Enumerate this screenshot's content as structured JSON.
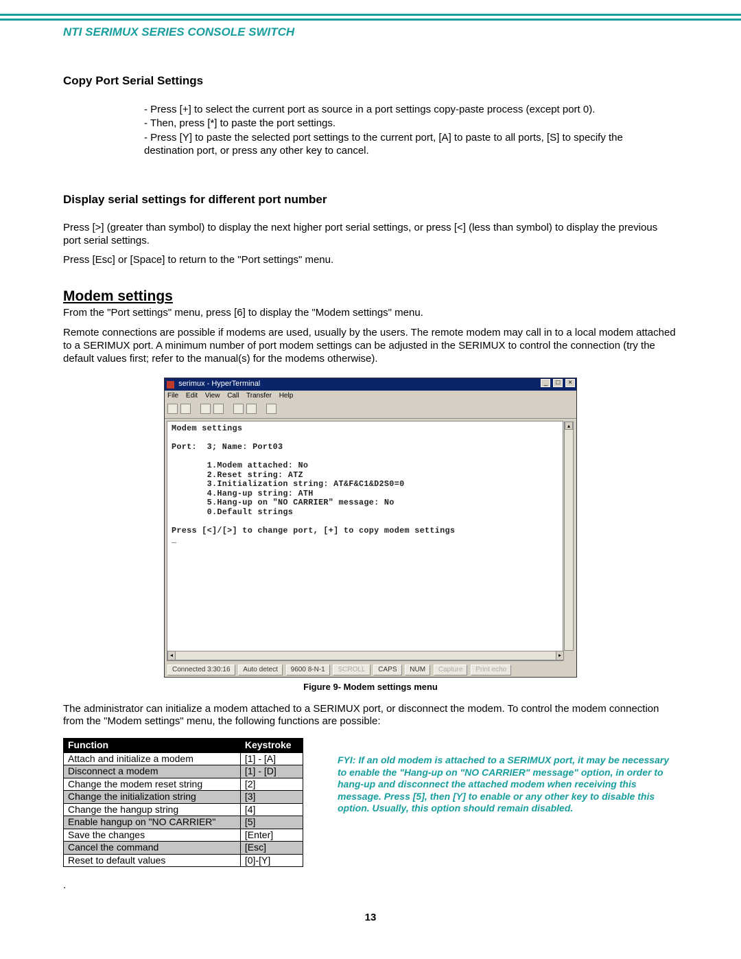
{
  "header": {
    "title": "NTI SERIMUX SERIES CONSOLE SWITCH"
  },
  "section1": {
    "heading": "Copy Port Serial Settings",
    "bullets": [
      "Press [+] to select the current port as source in a port settings copy-paste process (except port 0).",
      "Then, press [*] to paste the port settings.",
      "Press [Y]  to paste the selected port settings to the current port, [A] to paste to all ports, [S] to specify the destination port, or press any other key to cancel."
    ]
  },
  "section2": {
    "heading": "Display serial settings for different port number",
    "p1": "Press [>] (greater than symbol) to display the next higher port serial settings, or press [<] (less than symbol) to display the previous port serial settings.",
    "p2": "Press [Esc] or [Space] to return to the \"Port settings\" menu."
  },
  "section3": {
    "heading": "Modem settings",
    "p1": "From the \"Port settings\" menu, press [6] to display the \"Modem settings\" menu.",
    "p2": "Remote connections are possible if modems are used, usually by the users. The remote modem may call in to a local modem attached to a SERIMUX port.  A minimum number of port modem settings can be adjusted in the SERIMUX to control the connection (try the default values first; refer to the manual(s) for the modems otherwise)."
  },
  "terminal": {
    "windowTitle": "serimux - HyperTerminal",
    "menus": {
      "m0": "File",
      "m1": "Edit",
      "m2": "View",
      "m3": "Call",
      "m4": "Transfer",
      "m5": "Help"
    },
    "body": "Modem settings\n\nPort:  3; Name: Port03\n\n       1.Modem attached: No\n       2.Reset string: ATZ\n       3.Initialization string: AT&F&C1&D2S0=0\n       4.Hang-up string: ATH\n       5.Hang-up on \"NO CARRIER\" message: No\n       0.Default strings\n\nPress [<]/[>] to change port, [+] to copy modem settings\n_",
    "status": {
      "s0": "Connected 3:30:16",
      "s1": "Auto detect",
      "s2": "9600 8-N-1",
      "s3": "SCROLL",
      "s4": "CAPS",
      "s5": "NUM",
      "s6": "Capture",
      "s7": "Print echo"
    }
  },
  "figure": {
    "caption": "Figure 9- Modem settings menu"
  },
  "afterFigure": {
    "p1": "The administrator can initialize a modem attached to a SERIMUX port, or disconnect the modem.  To control the modem connection from the \"Modem settings\" menu, the following functions are possible:"
  },
  "table": {
    "h1": "Function",
    "h2": "Keystroke",
    "rows": [
      {
        "f": "Attach and initialize a modem",
        "k": "[1] - [A]"
      },
      {
        "f": "Disconnect a modem",
        "k": "[1] - [D]"
      },
      {
        "f": "Change the modem reset string",
        "k": "[2]"
      },
      {
        "f": "Change the initialization string",
        "k": "[3]"
      },
      {
        "f": "Change the hangup string",
        "k": "[4]"
      },
      {
        "f": "Enable hangup on \"NO CARRIER\"",
        "k": "[5]"
      },
      {
        "f": "Save the changes",
        "k": "[Enter]"
      },
      {
        "f": "Cancel the command",
        "k": "[Esc]"
      },
      {
        "f": "Reset to default values",
        "k": "[0]-[Y]"
      }
    ]
  },
  "fyi": {
    "text": "FYI: If an old modem is attached to a SERIMUX port, it may be necessary to enable the \"Hang-up on \"NO CARRIER\" message\" option, in order to hang-up and disconnect the attached modem when receiving this message. Press [5], then [Y] to enable or any other key to disable this option. Usually, this option should remain disabled."
  },
  "pagenum": "13",
  "dot": "."
}
